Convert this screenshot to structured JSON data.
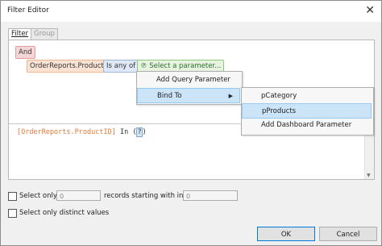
{
  "window": {
    "title": "Filter Editor",
    "close_glyph": "✕"
  },
  "tabs": [
    {
      "label": "Filter"
    },
    {
      "label": "Group Filter"
    }
  ],
  "filter": {
    "group_op": "And",
    "field": "OrderReports.ProductID",
    "operator": "Is any of",
    "param_icon": "parameter-icon",
    "param_glyph": "℗",
    "param_placeholder": "Select a parameter..."
  },
  "context_menu": {
    "items": [
      {
        "label": "Add Query Parameter"
      },
      {
        "label": "Bind To",
        "arrow": "▶"
      }
    ]
  },
  "submenu": {
    "items": [
      {
        "label": "pCategory"
      },
      {
        "label": "pProducts"
      },
      {
        "label": "Add Dashboard Parameter"
      }
    ]
  },
  "expression": {
    "field": "[OrderReports.ProductID]",
    "keyword": "In",
    "open": "(",
    "value": "?",
    "close": ")"
  },
  "options": {
    "select_only_label": "Select only",
    "select_only_value": "0",
    "records_label": "records starting with index",
    "index_value": "0",
    "distinct_label": "Select only distinct values"
  },
  "buttons": {
    "ok": "OK",
    "cancel": "Cancel"
  },
  "colors": {
    "accent": "#0078d7",
    "field_orange": "#e07c3a",
    "highlight": "#cce4f7"
  }
}
